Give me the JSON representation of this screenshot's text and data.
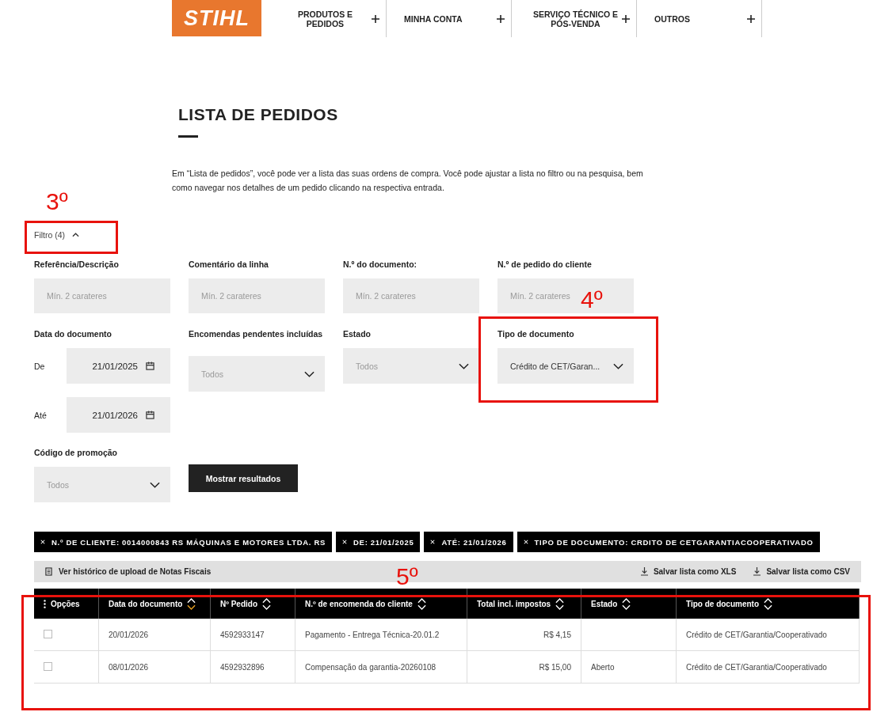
{
  "header": {
    "logo": "STIHL",
    "nav": [
      {
        "label": "PRODUTOS E PEDIDOS"
      },
      {
        "label": "MINHA CONTA"
      },
      {
        "label": "SERVIÇO TÉCNICO E PÓS-VENDA"
      },
      {
        "label": "OUTROS"
      }
    ]
  },
  "page": {
    "title": "LISTA DE PEDIDOS",
    "description": "Em “Lista de pedidos”, você pode ver a lista das suas ordens de compra. Você pode ajustar a lista no filtro ou na pesquisa, bem como navegar nos detalhes de um pedido clicando na respectiva entrada."
  },
  "filter_toggle": {
    "label": "Filtro (4)",
    "expanded": true
  },
  "filters": {
    "text_fields": [
      {
        "label": "Referência/Descrição",
        "placeholder": "Mín. 2 carateres"
      },
      {
        "label": "Comentário da linha",
        "placeholder": "Mín. 2 carateres"
      },
      {
        "label": "N.º do documento:",
        "placeholder": "Mín. 2 carateres"
      },
      {
        "label": "N.º de pedido do cliente",
        "placeholder": "Mín. 2 carateres"
      }
    ],
    "date": {
      "label": "Data do documento",
      "from_label": "De",
      "from": "21/01/2025",
      "to_label": "Até",
      "to": "21/01/2026"
    },
    "selects": [
      {
        "label": "Encomendas pendentes incluídas",
        "placeholder": "Todos"
      },
      {
        "label": "Estado",
        "placeholder": "Todos"
      },
      {
        "label": "Tipo de documento",
        "value": "Crédito de CET/Garan..."
      }
    ],
    "promo": {
      "label": "Código de promoção",
      "placeholder": "Todos"
    },
    "submit": "Mostrar resultados"
  },
  "chips": [
    "N.º DE CLIENTE: 0014000843 RS MÁQUINAS E MOTORES LTDA. RS",
    "DE: 21/01/2025",
    "ATÉ: 21/01/2026",
    "TIPO DE DOCUMENTO: CRDITO DE CETGARANTIACOOPERATIVADO"
  ],
  "toolbar": {
    "history_link": "Ver histórico de upload de Notas Fiscais",
    "exports": [
      "Salvar lista como XLS",
      "Salvar lista como CSV"
    ]
  },
  "table": {
    "columns": [
      {
        "label": "Opções",
        "kind": "options"
      },
      {
        "label": "Data do documento",
        "kind": "text",
        "sorted": true
      },
      {
        "label": "Nº Pedido",
        "kind": "text",
        "sorted": false
      },
      {
        "label": "N.º de encomenda do cliente",
        "kind": "text",
        "sorted": false
      },
      {
        "label": "Total incl. impostos",
        "kind": "amount",
        "sorted": false
      },
      {
        "label": "Estado",
        "kind": "text",
        "sorted": false
      },
      {
        "label": "Tipo de documento",
        "kind": "text",
        "sorted": false
      }
    ],
    "rows": [
      {
        "checked": false,
        "cells": [
          "",
          "20/01/2026",
          "4592933147",
          "Pagamento - Entrega Técnica-20.01.2",
          "R$ 4,15",
          "",
          "Crédito de CET/Garantia/Cooperativado"
        ]
      },
      {
        "checked": false,
        "cells": [
          "",
          "08/01/2026",
          "4592932896",
          "Compensação da garantia-20260108",
          "R$ 15,00",
          "Aberto",
          "Crédito de CET/Garantia/Cooperativado"
        ]
      }
    ]
  },
  "annotations": [
    {
      "label": "3º"
    },
    {
      "label": "4º"
    },
    {
      "label": "5º"
    }
  ]
}
